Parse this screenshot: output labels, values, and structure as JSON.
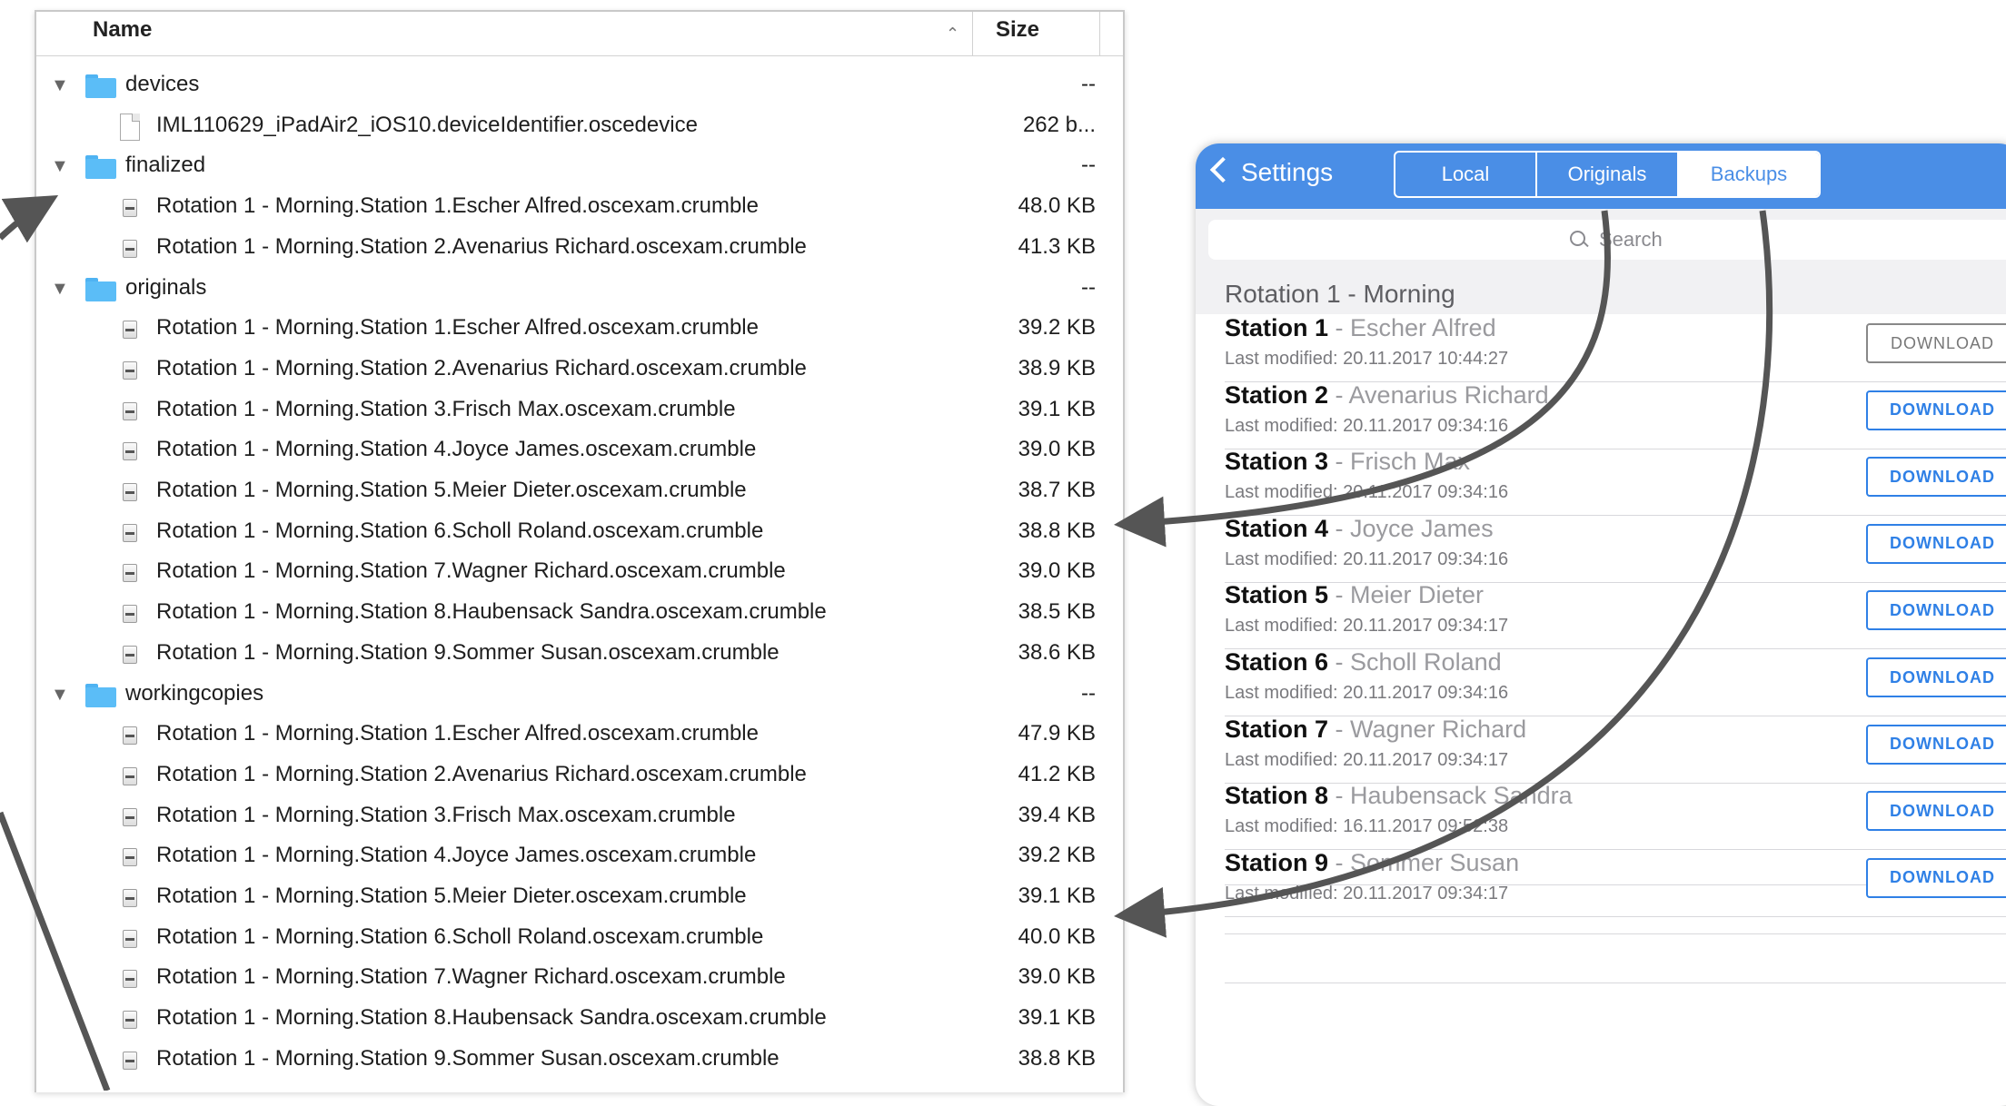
{
  "finder": {
    "header": {
      "name_label": "Name",
      "size_label": "Size",
      "sort_glyph": "^"
    },
    "rows": [
      {
        "kind": "folder",
        "name": "devices",
        "size": "--"
      },
      {
        "kind": "doc",
        "name": "IML110629_iPadAir2_iOS10.deviceIdentifier.oscedevice",
        "size": "262 b..."
      },
      {
        "kind": "folder",
        "name": "finalized",
        "size": "--"
      },
      {
        "kind": "file",
        "name": "Rotation 1 - Morning.Station 1.Escher Alfred.oscexam.crumble",
        "size": "48.0 KB"
      },
      {
        "kind": "file",
        "name": "Rotation 1 - Morning.Station 2.Avenarius Richard.oscexam.crumble",
        "size": "41.3 KB"
      },
      {
        "kind": "folder",
        "name": "originals",
        "size": "--"
      },
      {
        "kind": "file",
        "name": "Rotation 1 - Morning.Station 1.Escher Alfred.oscexam.crumble",
        "size": "39.2 KB"
      },
      {
        "kind": "file",
        "name": "Rotation 1 - Morning.Station 2.Avenarius Richard.oscexam.crumble",
        "size": "38.9 KB"
      },
      {
        "kind": "file",
        "name": "Rotation 1 - Morning.Station 3.Frisch Max.oscexam.crumble",
        "size": "39.1 KB"
      },
      {
        "kind": "file",
        "name": "Rotation 1 - Morning.Station 4.Joyce James.oscexam.crumble",
        "size": "39.0 KB"
      },
      {
        "kind": "file",
        "name": "Rotation 1 - Morning.Station 5.Meier Dieter.oscexam.crumble",
        "size": "38.7 KB"
      },
      {
        "kind": "file",
        "name": "Rotation 1 - Morning.Station 6.Scholl Roland.oscexam.crumble",
        "size": "38.8 KB"
      },
      {
        "kind": "file",
        "name": "Rotation 1 - Morning.Station 7.Wagner Richard.oscexam.crumble",
        "size": "39.0 KB"
      },
      {
        "kind": "file",
        "name": "Rotation 1 - Morning.Station 8.Haubensack Sandra.oscexam.crumble",
        "size": "38.5 KB"
      },
      {
        "kind": "file",
        "name": "Rotation 1 - Morning.Station 9.Sommer Susan.oscexam.crumble",
        "size": "38.6 KB"
      },
      {
        "kind": "folder",
        "name": "workingcopies",
        "size": "--"
      },
      {
        "kind": "file",
        "name": "Rotation 1 - Morning.Station 1.Escher Alfred.oscexam.crumble",
        "size": "47.9 KB"
      },
      {
        "kind": "file",
        "name": "Rotation 1 - Morning.Station 2.Avenarius Richard.oscexam.crumble",
        "size": "41.2 KB"
      },
      {
        "kind": "file",
        "name": "Rotation 1 - Morning.Station 3.Frisch Max.oscexam.crumble",
        "size": "39.4 KB"
      },
      {
        "kind": "file",
        "name": "Rotation 1 - Morning.Station 4.Joyce James.oscexam.crumble",
        "size": "39.2 KB"
      },
      {
        "kind": "file",
        "name": "Rotation 1 - Morning.Station 5.Meier Dieter.oscexam.crumble",
        "size": "39.1 KB"
      },
      {
        "kind": "file",
        "name": "Rotation 1 - Morning.Station 6.Scholl Roland.oscexam.crumble",
        "size": "40.0 KB"
      },
      {
        "kind": "file",
        "name": "Rotation 1 - Morning.Station 7.Wagner Richard.oscexam.crumble",
        "size": "39.0 KB"
      },
      {
        "kind": "file",
        "name": "Rotation 1 - Morning.Station 8.Haubensack Sandra.oscexam.crumble",
        "size": "39.1 KB"
      },
      {
        "kind": "file",
        "name": "Rotation 1 - Morning.Station 9.Sommer Susan.oscexam.crumble",
        "size": "38.8 KB"
      }
    ]
  },
  "ipad": {
    "back_label": "Settings",
    "segments": [
      {
        "label": "Local",
        "active": false
      },
      {
        "label": "Originals",
        "active": false
      },
      {
        "label": "Backups",
        "active": true
      }
    ],
    "search_placeholder": "Search",
    "section_title": "Rotation 1 - Morning",
    "download_label": "DOWNLOAD",
    "stations": [
      {
        "label": "Station 1",
        "person": "Escher Alfred",
        "modified": "Last modified: 20.11.2017 10:44:27",
        "enabled": false
      },
      {
        "label": "Station 2",
        "person": "Avenarius Richard",
        "modified": "Last modified: 20.11.2017 09:34:16",
        "enabled": true
      },
      {
        "label": "Station 3",
        "person": "Frisch Max",
        "modified": "Last modified: 20.11.2017 09:34:16",
        "enabled": true
      },
      {
        "label": "Station 4",
        "person": "Joyce James",
        "modified": "Last modified: 20.11.2017 09:34:16",
        "enabled": true
      },
      {
        "label": "Station 5",
        "person": "Meier Dieter",
        "modified": "Last modified: 20.11.2017 09:34:17",
        "enabled": true
      },
      {
        "label": "Station 6",
        "person": "Scholl Roland",
        "modified": "Last modified: 20.11.2017 09:34:16",
        "enabled": true
      },
      {
        "label": "Station 7",
        "person": "Wagner Richard",
        "modified": "Last modified: 20.11.2017 09:34:17",
        "enabled": true
      },
      {
        "label": "Station 8",
        "person": "Haubensack Sandra",
        "modified": "Last modified: 16.11.2017 09:52:38",
        "enabled": true
      },
      {
        "label": "Station 9",
        "person": "Sommer Susan",
        "modified": "Last modified: 20.11.2017 09:34:17",
        "enabled": true
      }
    ]
  },
  "colors": {
    "nav_blue": "#4a8ee6",
    "button_blue": "#2f80e6",
    "folder_blue": "#5bbdf7",
    "arrow": "#555555"
  }
}
